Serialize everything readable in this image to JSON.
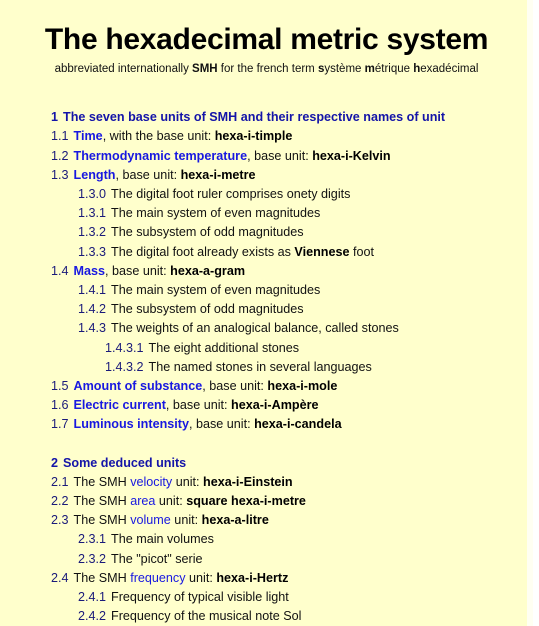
{
  "document": {
    "title": "The hexadecimal metric system",
    "subtitle": {
      "part1": "abbreviated internationally ",
      "abbr": "SMH",
      "part2": " for the french term ",
      "s": "s",
      "ystem": "ystème ",
      "m": "m",
      "etrique": "étrique ",
      "h": "h",
      "exadecimal": "exadécimal"
    }
  },
  "colors": {
    "background": "#ffffcc",
    "link": "#1818e0",
    "heading": "#1414a8",
    "number": "#1a1a7a",
    "text": "#111111"
  },
  "toc": [
    {
      "level": 1,
      "number": "1",
      "title": "The seven base units of SMH and their respective names of unit",
      "spacer": false
    },
    {
      "level": 2,
      "number": "1.1",
      "link": "Time",
      "link_bold": true,
      "text": ", with the base unit: ",
      "unit": "hexa-i-timple"
    },
    {
      "level": 2,
      "number": "1.2",
      "link": "Thermodynamic temperature",
      "link_bold": true,
      "text": ", base unit: ",
      "unit": "hexa-i-Kelvin"
    },
    {
      "level": 2,
      "number": "1.3",
      "link": "Length",
      "link_bold": true,
      "text": ", base unit: ",
      "unit": "hexa-i-metre"
    },
    {
      "level": 3,
      "number": "1.3.0",
      "text": "The digital foot ruler comprises onety digits"
    },
    {
      "level": 3,
      "number": "1.3.1",
      "text": "The main system of even magnitudes"
    },
    {
      "level": 3,
      "number": "1.3.2",
      "text": "The subsystem of odd magnitudes"
    },
    {
      "level": 3,
      "number": "1.3.3",
      "text": "The digital foot already exists as ",
      "unit": "Viennese",
      "text_after": " foot"
    },
    {
      "level": 2,
      "number": "1.4",
      "link": "Mass",
      "link_bold": true,
      "text": ", base unit: ",
      "unit": "hexa-a-gram"
    },
    {
      "level": 3,
      "number": "1.4.1",
      "text": "The main system of even magnitudes"
    },
    {
      "level": 3,
      "number": "1.4.2",
      "text": "The subsystem of odd magnitudes"
    },
    {
      "level": 3,
      "number": "1.4.3",
      "text": "The weights of an analogical balance, called stones"
    },
    {
      "level": 4,
      "number": "1.4.3.1",
      "text": "The eight additional stones"
    },
    {
      "level": 4,
      "number": "1.4.3.2",
      "text": "The named stones in several languages"
    },
    {
      "level": 2,
      "number": "1.5",
      "link": "Amount of substance",
      "link_bold": true,
      "text": ", base unit: ",
      "unit": "hexa-i-mole"
    },
    {
      "level": 2,
      "number": "1.6",
      "link": "Electric current",
      "link_bold": true,
      "text": ", base unit: ",
      "unit": "hexa-i-Ampère"
    },
    {
      "level": 2,
      "number": "1.7",
      "link": "Luminous intensity",
      "link_bold": true,
      "text": ", base unit: ",
      "unit": "hexa-i-candela"
    },
    {
      "level": 1,
      "number": "2",
      "title": "Some deduced units",
      "spacer": true
    },
    {
      "level": 2,
      "number": "2.1",
      "text_before": "The SMH ",
      "link": "velocity",
      "link_bold": false,
      "text": " unit: ",
      "unit": "hexa-i-Einstein"
    },
    {
      "level": 2,
      "number": "2.2",
      "text_before": "The SMH ",
      "link": "area",
      "link_bold": false,
      "text": " unit: ",
      "unit": "square hexa-i-metre"
    },
    {
      "level": 2,
      "number": "2.3",
      "text_before": "The SMH ",
      "link": "volume",
      "link_bold": false,
      "text": " unit: ",
      "unit": "hexa-a-litre"
    },
    {
      "level": 3,
      "number": "2.3.1",
      "text": "The main volumes"
    },
    {
      "level": 3,
      "number": "2.3.2",
      "text": "The \"picot\" serie"
    },
    {
      "level": 2,
      "number": "2.4",
      "text_before": "The SMH ",
      "link": "frequency",
      "link_bold": false,
      "text": " unit: ",
      "unit": "hexa-i-Hertz"
    },
    {
      "level": 3,
      "number": "2.4.1",
      "text": "Frequency of typical visible light"
    },
    {
      "level": 3,
      "number": "2.4.2",
      "text": "Frequency of the musical note Sol"
    }
  ]
}
